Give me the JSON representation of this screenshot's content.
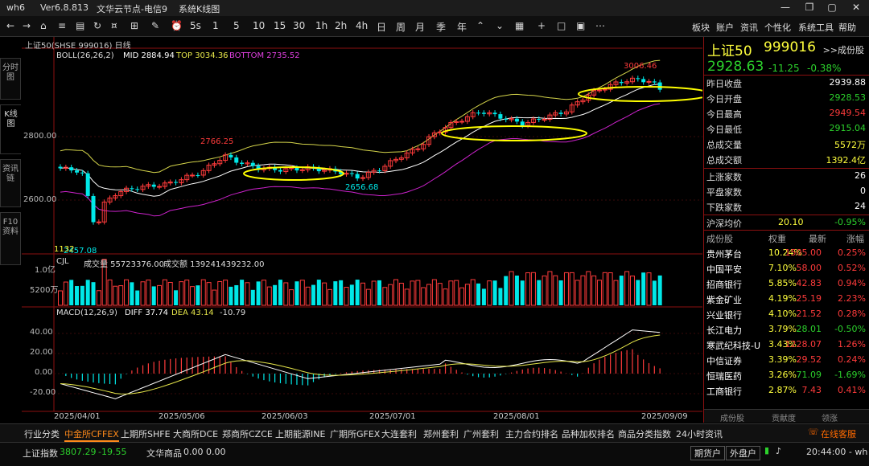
{
  "titlebar": {
    "app": "wh6",
    "version": "Ver6.8.813",
    "node": "文华云节点-电信9",
    "page": "系统K线图",
    "min": "—",
    "restore": "❐",
    "max": "▢",
    "close": "✕"
  },
  "toolbar": {
    "periods": [
      "5s",
      "1",
      "5",
      "10",
      "15",
      "30",
      "1h",
      "2h",
      "4h",
      "日",
      "周",
      "月",
      "季",
      "年"
    ],
    "menu": [
      "板块",
      "账户",
      "资讯",
      "个性化",
      "系统工具",
      "帮助"
    ]
  },
  "lefttabs": [
    "分时图",
    "K线图",
    "资讯链",
    "F10资料"
  ],
  "chart": {
    "header": "上证50(SHSE 999016)  日线",
    "boll": {
      "name": "BOLL(26,26,2)",
      "mid": "MID 2884.94",
      "top": "TOP 3034.36",
      "bottom": "BOTTOM 2735.52"
    },
    "y_price": [
      "2800.00",
      "2600.00"
    ],
    "annot": {
      "high1": "2766.25",
      "low1": "2656.68",
      "high2": "3006.46",
      "low0": "2457.08",
      "left": "1132"
    },
    "cjl": {
      "name": "CJL",
      "vol": "成交量 55723376.00",
      "amt": "成交额 139241439232.00"
    },
    "y_vol": [
      "1.0亿",
      "5200万"
    ],
    "macd": {
      "name": "MACD(12,26,9)",
      "diff": "DIFF 37.74",
      "dea": "DEA 43.14",
      "val": "-10.79"
    },
    "y_macd": [
      "40.00",
      "20.00",
      "0.00",
      "-20.00"
    ],
    "dates": [
      "2025/04/01",
      "2025/05/06",
      "2025/06/03",
      "2025/07/01",
      "2025/08/01",
      "2025/09/09"
    ]
  },
  "quote": {
    "name": "上证50",
    "code": "999016",
    "fav": ">>成份股",
    "price": "2928.63",
    "change": "-11.25",
    "pct": "-0.38%",
    "rows": [
      {
        "k": "昨日收盘",
        "v": "2939.88",
        "c": "white"
      },
      {
        "k": "今日开盘",
        "v": "2928.53",
        "c": "green"
      },
      {
        "k": "今日最高",
        "v": "2949.54",
        "c": "red"
      },
      {
        "k": "今日最低",
        "v": "2915.04",
        "c": "green"
      },
      {
        "k": "总成交量",
        "v": "5572万",
        "c": "yellow"
      },
      {
        "k": "总成交额",
        "v": "1392.4亿",
        "c": "yellow"
      }
    ],
    "rows2": [
      {
        "k": "上涨家数",
        "v": "26",
        "c": "white"
      },
      {
        "k": "平盘家数",
        "v": "0",
        "c": "white"
      },
      {
        "k": "下跌家数",
        "v": "24",
        "c": "white"
      }
    ],
    "hs": {
      "k": "沪深均价",
      "v": "20.10",
      "p": "-0.95%"
    }
  },
  "components": {
    "headers": [
      "成份股",
      "权重",
      "最新",
      "涨幅"
    ],
    "rows": [
      {
        "name": "贵州茅台",
        "w": "10.24%",
        "last": "1505.00",
        "chg": "0.25%",
        "up": true
      },
      {
        "name": "中国平安",
        "w": "7.10%",
        "last": "58.00",
        "chg": "0.52%",
        "up": true
      },
      {
        "name": "招商银行",
        "w": "5.85%",
        "last": "42.83",
        "chg": "0.94%",
        "up": true
      },
      {
        "name": "紫金矿业",
        "w": "4.19%",
        "last": "25.19",
        "chg": "2.23%",
        "up": true
      },
      {
        "name": "兴业银行",
        "w": "4.10%",
        "last": "21.52",
        "chg": "0.28%",
        "up": true
      },
      {
        "name": "长江电力",
        "w": "3.79%",
        "last": "28.01",
        "chg": "-0.50%",
        "up": false
      },
      {
        "name": "寒武纪科技-U",
        "w": "3.43%",
        "last": "1228.07",
        "chg": "1.26%",
        "up": true
      },
      {
        "name": "中信证券",
        "w": "3.39%",
        "last": "29.52",
        "chg": "0.24%",
        "up": true
      },
      {
        "name": "恒瑞医药",
        "w": "3.26%",
        "last": "71.09",
        "chg": "-1.69%",
        "up": false
      },
      {
        "name": "工商银行",
        "w": "2.87%",
        "last": "7.43",
        "chg": "0.41%",
        "up": true
      }
    ],
    "tabs": [
      "成份股",
      "贡献度",
      "领涨"
    ]
  },
  "bottomtabs": [
    "行业分类",
    "中金所CFFEX",
    "上期所SHFE",
    "大商所DCE",
    "郑商所CZCE",
    "上期能源INE",
    "广期所GFEX",
    "大连套利",
    "郑州套利",
    "广州套利",
    "主力合约排名",
    "品种加权排名",
    "商品分类指数",
    "24小时资讯"
  ],
  "service": "在线客服",
  "status": {
    "idx_name": "上证指数",
    "idx_val": "3807.29",
    "idx_chg": "-19.55",
    "goods": "文华商品",
    "g1": "0.00",
    "g2": "0.00",
    "b1": "期货户",
    "b2": "外盘户",
    "time": "20:44:00 - wh"
  },
  "colors": {
    "up": "#ff3b3b",
    "down": "#00e8e8",
    "boll_mid": "#ffffff",
    "boll_top": "#d4d44a",
    "boll_bot": "#cc22cc",
    "accent": "#ff6a00"
  }
}
